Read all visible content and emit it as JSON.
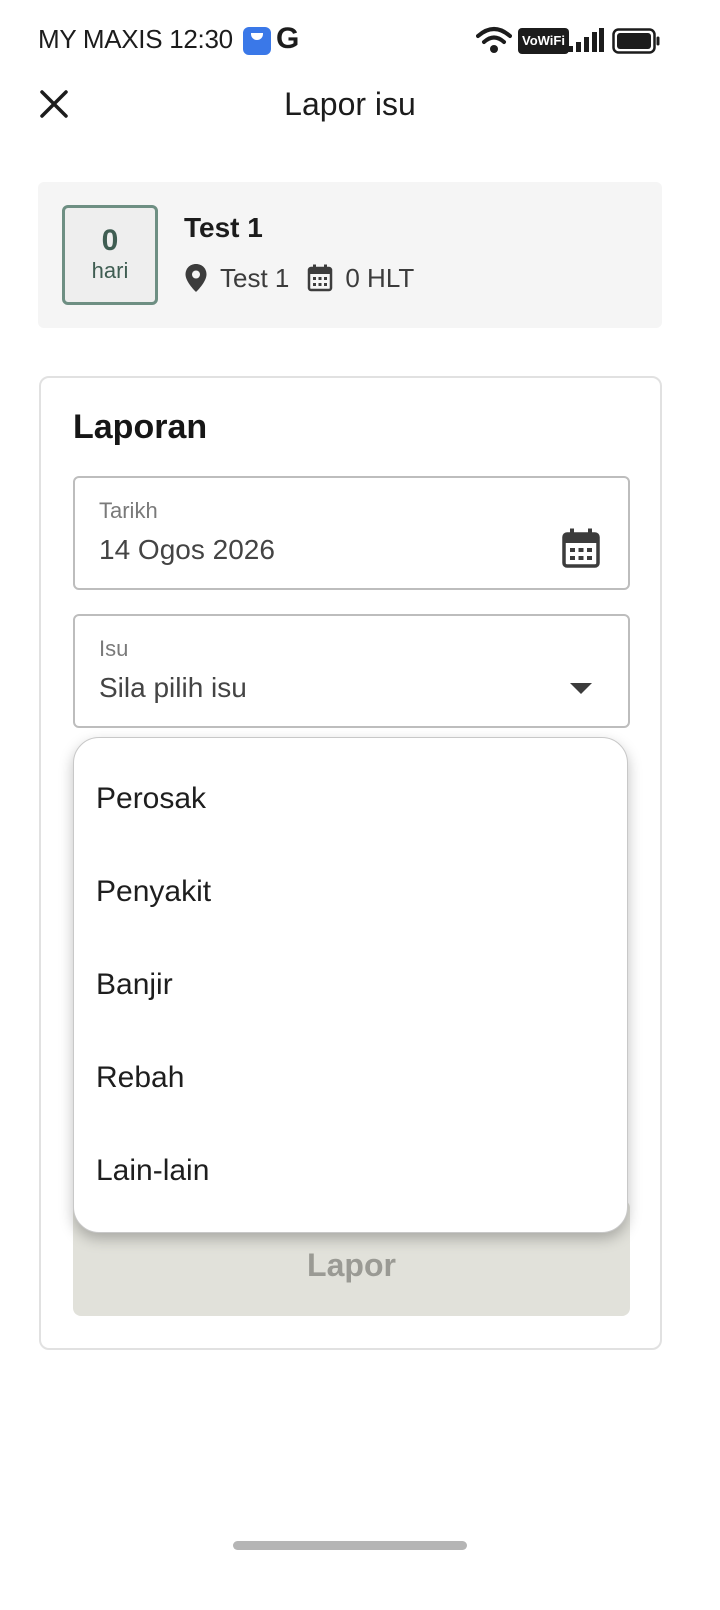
{
  "status_bar": {
    "carrier": "MY MAXIS",
    "time": "12:30",
    "google_glyph": "G",
    "vowifi": "VoWiFi"
  },
  "header": {
    "close_icon": "close-icon",
    "title": "Lapor isu"
  },
  "summary": {
    "day_count": "0",
    "day_unit": "hari",
    "plot_name": "Test 1",
    "location": "Test 1",
    "hlt": "0 HLT"
  },
  "report": {
    "title": "Laporan",
    "date_field": {
      "label": "Tarikh",
      "value": "14 Ogos 2026"
    },
    "issue_field": {
      "label": "Isu",
      "placeholder": "Sila pilih isu"
    },
    "submit_label": "Lapor"
  },
  "dropdown": {
    "options": [
      "Perosak",
      "Penyakit",
      "Banjir",
      "Rebah",
      "Lain-lain"
    ]
  },
  "colors": {
    "day_box_border": "#6e8f83",
    "day_box_text": "#3f5d52",
    "submit_bg": "#e1e1da",
    "submit_text": "#9a9a94"
  }
}
